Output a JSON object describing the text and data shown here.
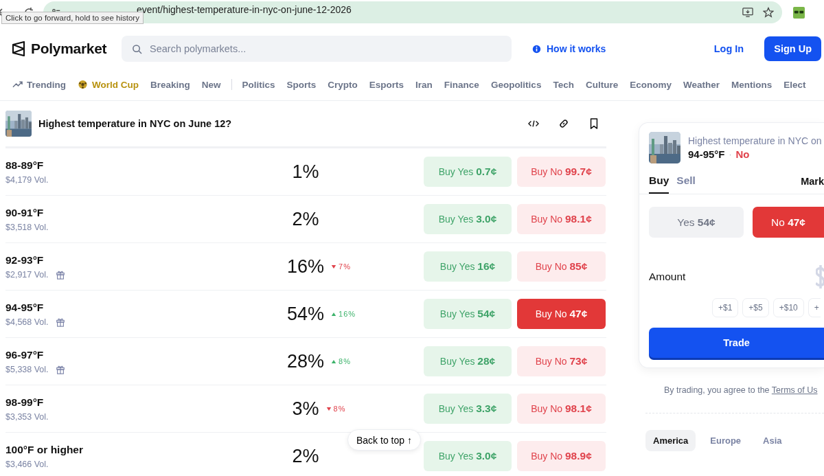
{
  "browser": {
    "url": "event/highest-temperature-in-nyc-on-june-12-2026",
    "tooltip": "Click to go forward, hold to see history"
  },
  "header": {
    "brand": "Polymarket",
    "search": {
      "placeholder": "Search polymarkets..."
    },
    "how_it_works": "How it works",
    "log_in": "Log In",
    "sign_up": "Sign Up"
  },
  "categories_primary": [
    {
      "label": "Trending",
      "kind": "trending"
    },
    {
      "label": "World Cup",
      "kind": "featured"
    },
    {
      "label": "Breaking",
      "kind": "plain"
    },
    {
      "label": "New",
      "kind": "plain"
    }
  ],
  "categories_topics": [
    "Politics",
    "Sports",
    "Crypto",
    "Esports",
    "Iran",
    "Finance",
    "Geopolitics",
    "Tech",
    "Culture",
    "Economy",
    "Weather",
    "Mentions",
    "Elect"
  ],
  "event": {
    "title": "Highest temperature in NYC on June 12?"
  },
  "outcomes": [
    {
      "label": "88-89°F",
      "volume": "$4,179 Vol.",
      "reward": false,
      "chance": "1%",
      "buy_yes": "Buy Yes",
      "yes_price": "0.7¢",
      "buy_no": "Buy No",
      "no_price": "99.7¢",
      "selected": false
    },
    {
      "label": "90-91°F",
      "volume": "$3,518 Vol.",
      "reward": false,
      "chance": "2%",
      "buy_yes": "Buy Yes",
      "yes_price": "3.0¢",
      "buy_no": "Buy No",
      "no_price": "98.1¢",
      "selected": false
    },
    {
      "label": "92-93°F",
      "volume": "$2,917 Vol.",
      "reward": true,
      "chance": "16%",
      "change": {
        "rising": false,
        "text": "7%"
      },
      "buy_yes": "Buy Yes",
      "yes_price": "16¢",
      "buy_no": "Buy No",
      "no_price": "85¢",
      "selected": false
    },
    {
      "label": "94-95°F",
      "volume": "$4,568 Vol.",
      "reward": true,
      "chance": "54%",
      "change": {
        "rising": true,
        "text": "16%"
      },
      "buy_yes": "Buy Yes",
      "yes_price": "54¢",
      "buy_no": "Buy No",
      "no_price": "47¢",
      "selected": true
    },
    {
      "label": "96-97°F",
      "volume": "$5,338 Vol.",
      "reward": true,
      "chance": "28%",
      "change": {
        "rising": true,
        "text": "8%"
      },
      "buy_yes": "Buy Yes",
      "yes_price": "28¢",
      "buy_no": "Buy No",
      "no_price": "73¢",
      "selected": false
    },
    {
      "label": "98-99°F",
      "volume": "$3,353 Vol.",
      "reward": false,
      "chance": "3%",
      "change": {
        "rising": false,
        "text": "8%"
      },
      "buy_yes": "Buy Yes",
      "yes_price": "3.3¢",
      "buy_no": "Buy No",
      "no_price": "98.1¢",
      "selected": false
    },
    {
      "label": "100°F or higher",
      "volume": "$3,466 Vol.",
      "reward": false,
      "chance": "2%",
      "buy_yes": "Buy Yes",
      "yes_price": "3.0¢",
      "buy_no": "Buy No",
      "no_price": "98.9¢",
      "selected": false
    }
  ],
  "back_to_top": "Back to top ↑",
  "order_panel": {
    "market": "Highest temperature in NYC on",
    "outcome": "94-95°F",
    "separator": "·",
    "side": "No",
    "tabs": [
      {
        "label": "Buy",
        "selected": true
      },
      {
        "label": "Sell",
        "selected": false
      }
    ],
    "order_type": "Mark",
    "options": [
      {
        "label": "Yes",
        "price": "54¢",
        "selected": false
      },
      {
        "label": "No",
        "price": "47¢",
        "selected": true
      }
    ],
    "amount_label": "Amount",
    "quick_amounts": [
      "+$1",
      "+$5",
      "+$10",
      "+"
    ],
    "trade": "Trade",
    "disclaimer": "By trading, you agree to the",
    "terms_link": "Terms of Us"
  },
  "regions": [
    {
      "label": "America",
      "selected": true
    },
    {
      "label": "Europe",
      "selected": false
    },
    {
      "label": "Asia",
      "selected": false
    }
  ]
}
